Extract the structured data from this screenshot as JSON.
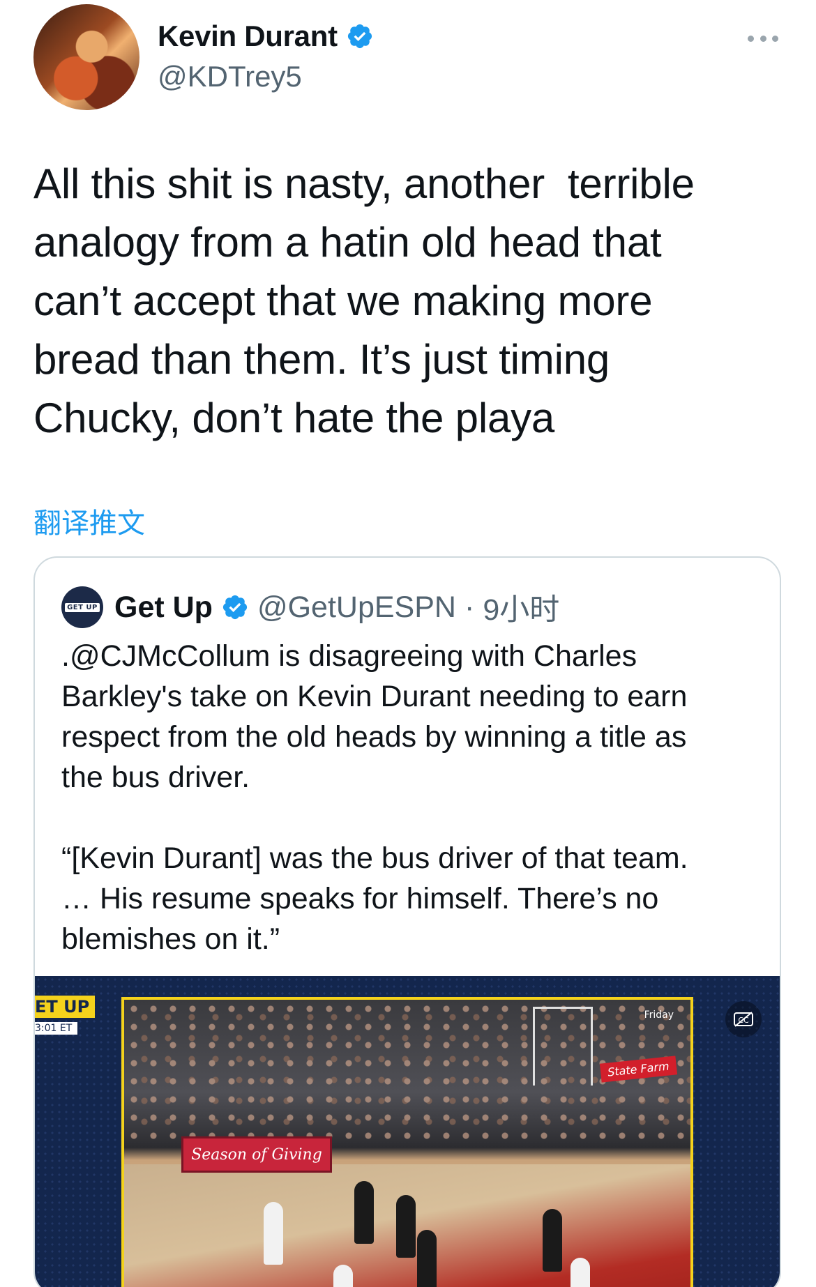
{
  "tweet": {
    "author_name": "Kevin Durant",
    "author_handle": "@KDTrey5",
    "text": "All this shit is nasty, another  terrible\nanalogy from a hatin old head that\ncan’t accept that we making more\nbread than them. It’s just timing\nChucky, don’t hate the playa",
    "translate_label": "翻译推文",
    "menu_icon": "more-horizontal-icon",
    "verified_icon": "verified-badge-icon"
  },
  "quote": {
    "author_name": "Get Up",
    "author_handle": "@GetUpESPN",
    "separator": "·",
    "time": "9小时",
    "logo_text": "GET UP",
    "text": ".@CJMcCollum is disagreeing with Charles\nBarkley's take on Kevin Durant needing to earn\nrespect from the old heads by winning a title as\nthe bus driver.\n\n“[Kevin Durant] was the bus driver of that team.\n… His resume speaks for himself. There’s no\nblemishes on it.”"
  },
  "video": {
    "corner_brand": "ET UP",
    "corner_time": "3:01 ET",
    "banner_text": "Season of Giving",
    "day_label": "Friday",
    "sponsor_text": "State Farm",
    "caption_icon": "closed-captions-icon"
  },
  "colors": {
    "link": "#1d9bf0",
    "secondary_text": "#536471",
    "primary_text": "#0f1419",
    "card_border": "#cfd9de",
    "video_bg": "#13264d",
    "frame": "#f4d21c"
  }
}
